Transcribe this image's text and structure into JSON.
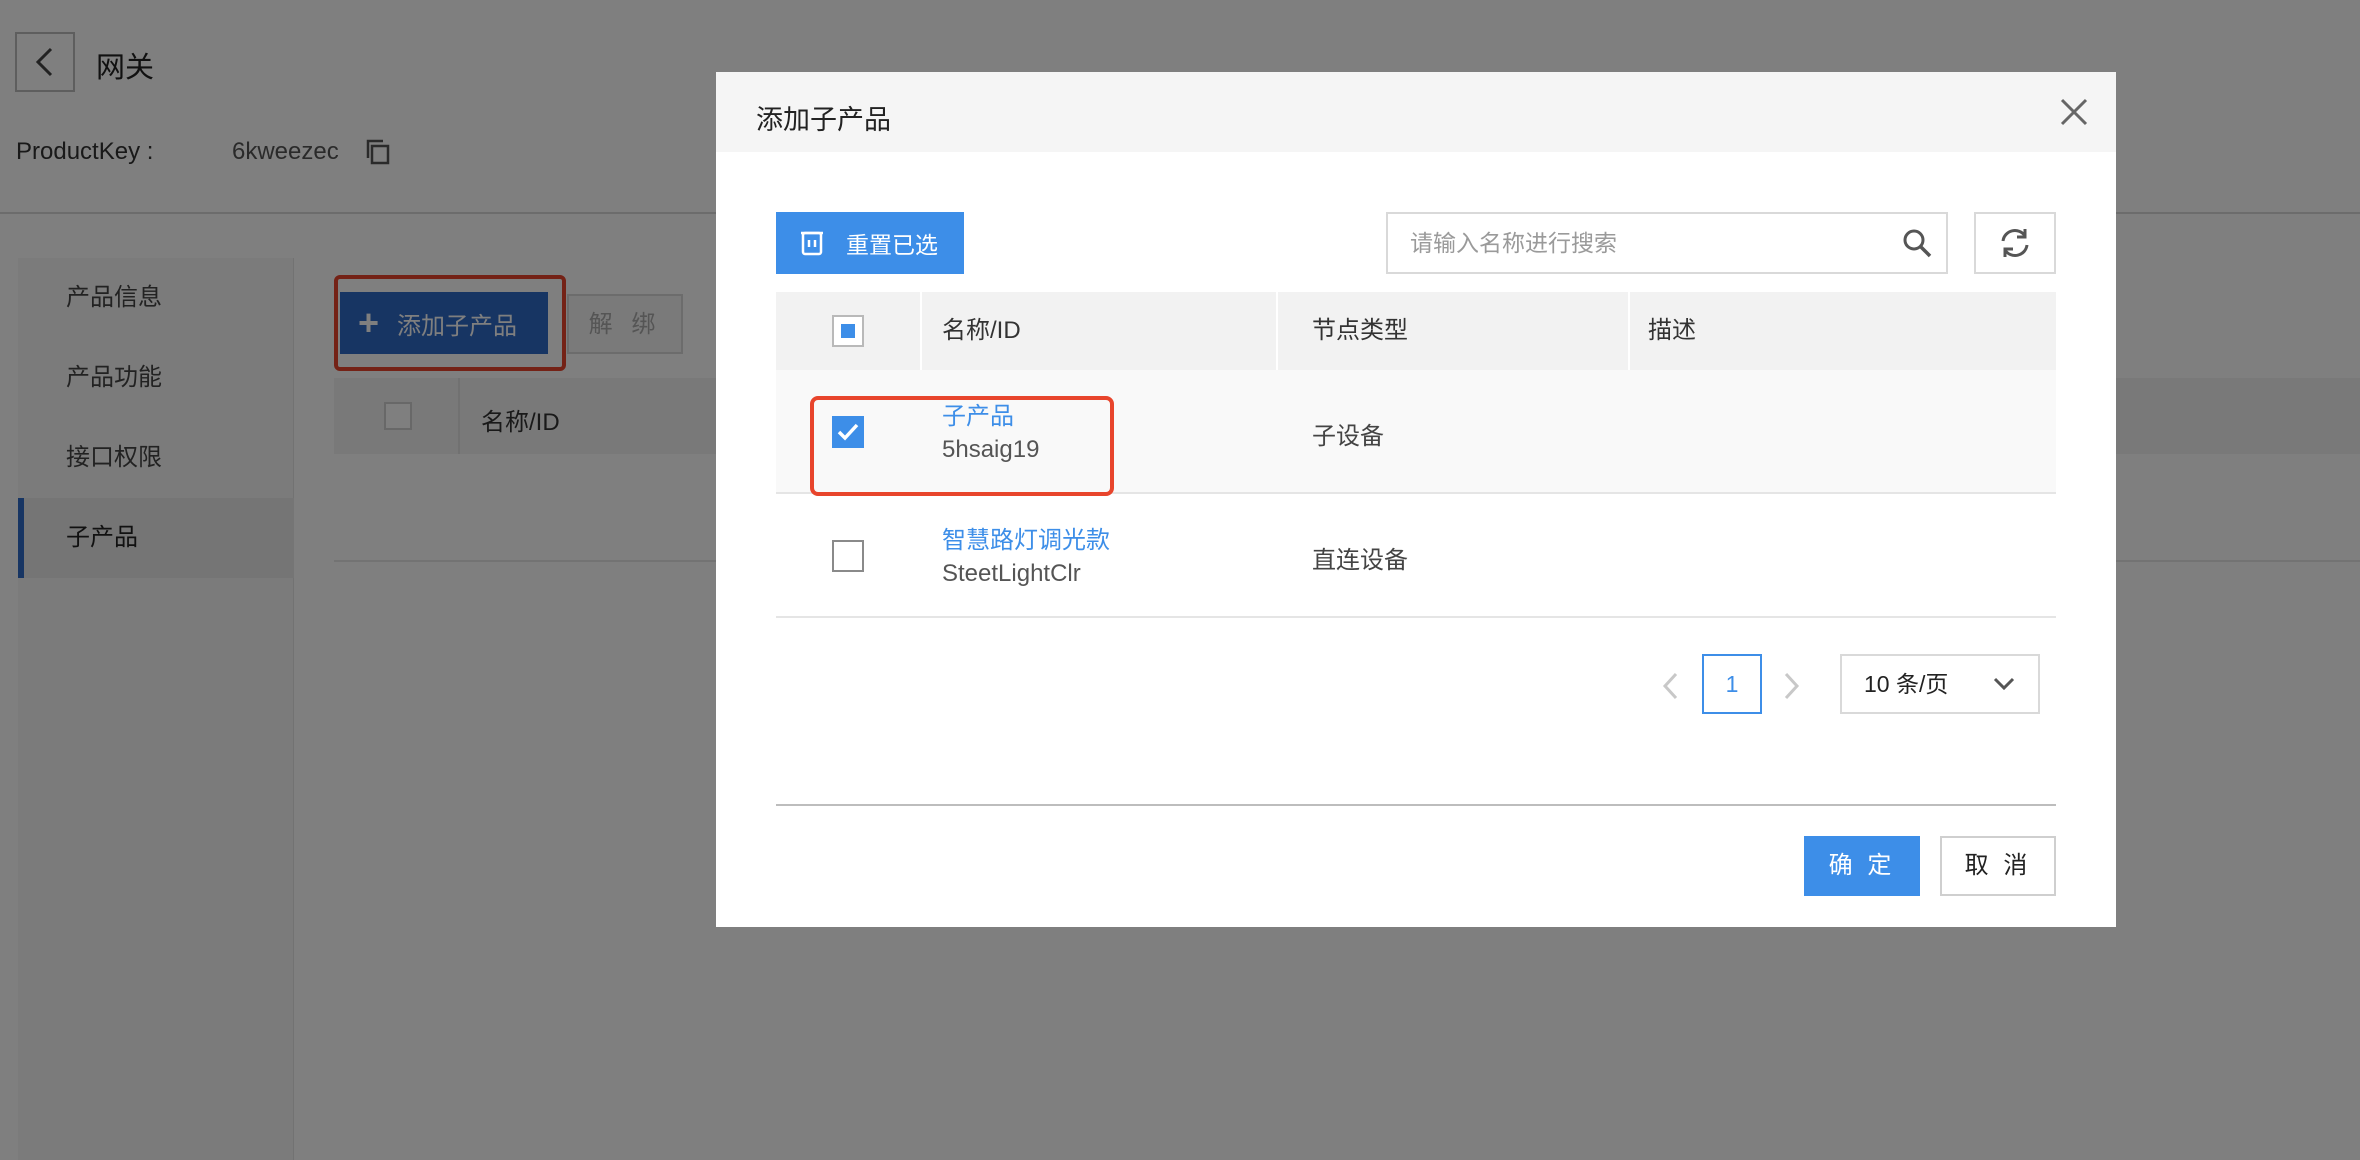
{
  "header": {
    "title": "网关",
    "product_key_label": "ProductKey :",
    "product_key_value": "6kweezec"
  },
  "sidebar": {
    "items": [
      {
        "label": "产品信息",
        "active": false
      },
      {
        "label": "产品功能",
        "active": false
      },
      {
        "label": "接口权限",
        "active": false
      },
      {
        "label": "子产品",
        "active": true
      }
    ]
  },
  "toolbar": {
    "add_sub_product_label": "添加子产品",
    "unbind_label": "解 绑"
  },
  "background_table": {
    "columns": [
      "名称/ID"
    ]
  },
  "modal": {
    "title": "添加子产品",
    "reset_selection_label": "重置已选",
    "search": {
      "placeholder": "请输入名称进行搜索",
      "value": ""
    },
    "table": {
      "columns": [
        "名称/ID",
        "节点类型",
        "描述"
      ],
      "rows": [
        {
          "name": "子产品",
          "id": "5hsaig19",
          "node_type": "子设备",
          "description": "",
          "checked": true
        },
        {
          "name": "智慧路灯调光款",
          "id": "SteetLightClr",
          "node_type": "直连设备",
          "description": "",
          "checked": false
        }
      ]
    },
    "pagination": {
      "current_page": "1",
      "page_size": "10 条/页"
    },
    "confirm_label": "确 定",
    "cancel_label": "取 消"
  },
  "colors": {
    "primary": "#3d8ee8",
    "dark_primary": "#2f6bc6",
    "highlight": "#e8452c",
    "overlay": "rgba(0,0,0,0.5)"
  }
}
